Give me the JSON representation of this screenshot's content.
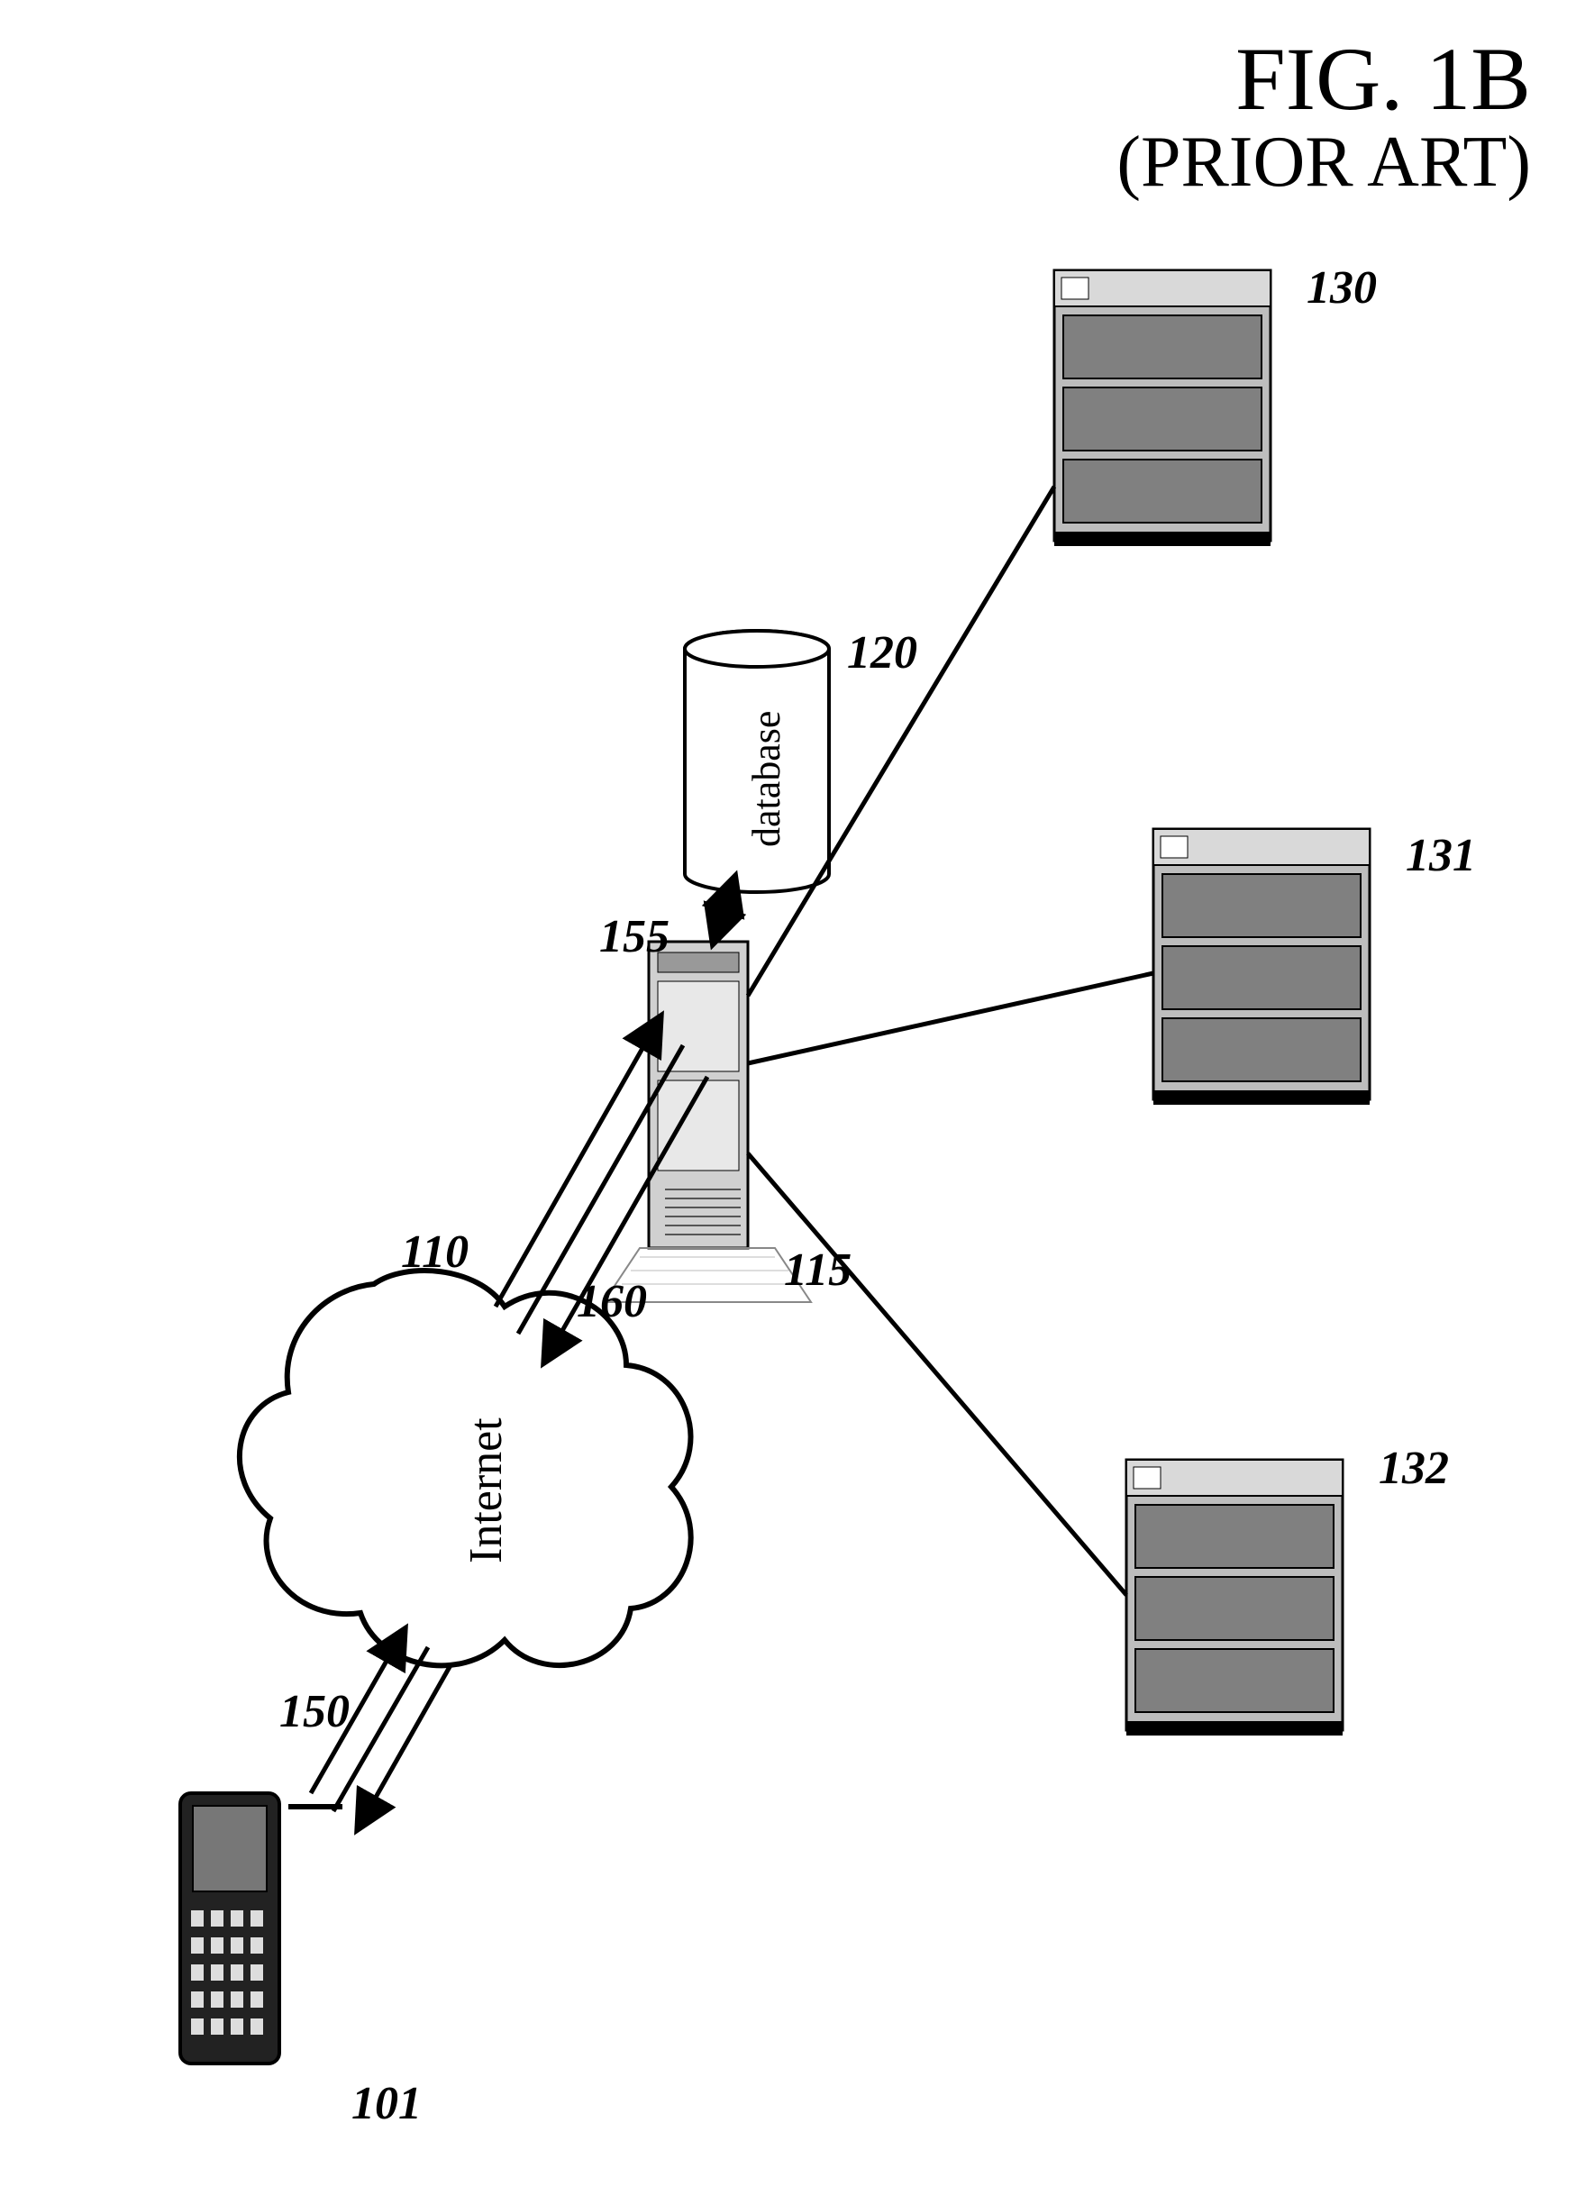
{
  "figure": {
    "title_line1": "FIG. 1B",
    "title_line2": "(PRIOR ART)",
    "cloud_label": "Internet",
    "database_label": "database",
    "refs": {
      "r101": "101",
      "r110": "110",
      "r115": "115",
      "r120": "120",
      "r130": "130",
      "r131": "131",
      "r132": "132",
      "r150": "150",
      "r155": "155",
      "r160": "160"
    }
  }
}
